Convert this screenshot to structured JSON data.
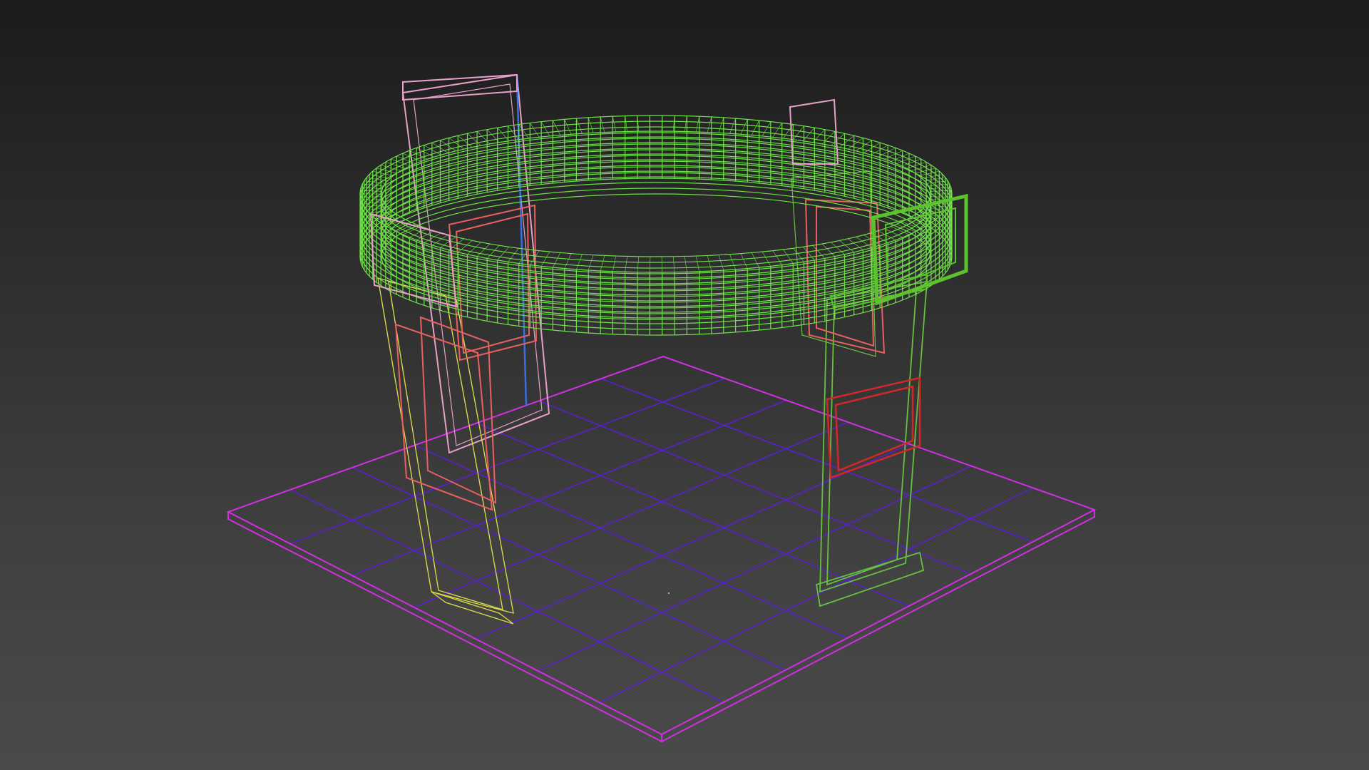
{
  "viewport": {
    "background_top": "#1b1b1b",
    "background_bottom": "#4a4a4a"
  },
  "scene": {
    "objects": [
      {
        "name": "ground-plane-grid",
        "color": "#5a1fd0",
        "edge_color": "#d030e0"
      },
      {
        "name": "circular-ring-rail",
        "color": "#6fe04a"
      },
      {
        "name": "handle-bracket",
        "color": "#5cc22e"
      },
      {
        "name": "back-left-leg",
        "color": "#e8a0c8"
      },
      {
        "name": "front-left-leg",
        "color": "#d8d84a"
      },
      {
        "name": "right-leg",
        "color": "#68c040"
      },
      {
        "name": "panels",
        "color": "#e86060"
      }
    ],
    "grid_divisions": 7
  }
}
